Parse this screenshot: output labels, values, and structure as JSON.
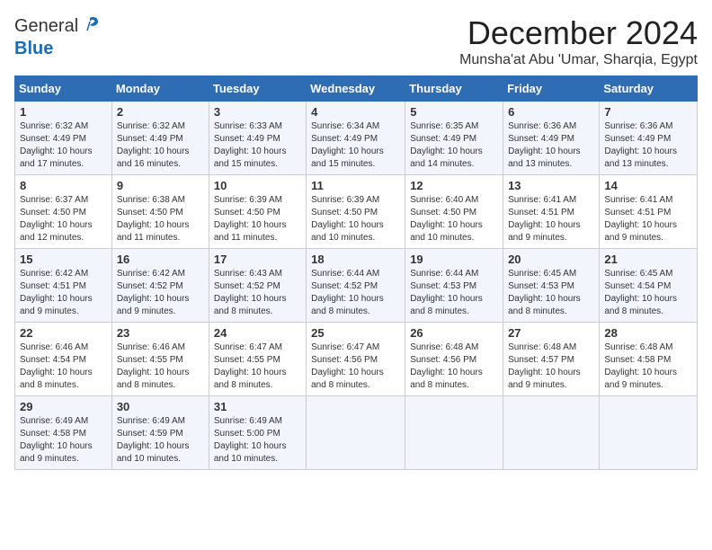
{
  "header": {
    "logo_general": "General",
    "logo_blue": "Blue",
    "month_year": "December 2024",
    "location": "Munsha'at Abu 'Umar, Sharqia, Egypt"
  },
  "days_of_week": [
    "Sunday",
    "Monday",
    "Tuesday",
    "Wednesday",
    "Thursday",
    "Friday",
    "Saturday"
  ],
  "weeks": [
    [
      {
        "day": "1",
        "sunrise": "6:32 AM",
        "sunset": "4:49 PM",
        "daylight": "10 hours and 17 minutes."
      },
      {
        "day": "2",
        "sunrise": "6:32 AM",
        "sunset": "4:49 PM",
        "daylight": "10 hours and 16 minutes."
      },
      {
        "day": "3",
        "sunrise": "6:33 AM",
        "sunset": "4:49 PM",
        "daylight": "10 hours and 15 minutes."
      },
      {
        "day": "4",
        "sunrise": "6:34 AM",
        "sunset": "4:49 PM",
        "daylight": "10 hours and 15 minutes."
      },
      {
        "day": "5",
        "sunrise": "6:35 AM",
        "sunset": "4:49 PM",
        "daylight": "10 hours and 14 minutes."
      },
      {
        "day": "6",
        "sunrise": "6:36 AM",
        "sunset": "4:49 PM",
        "daylight": "10 hours and 13 minutes."
      },
      {
        "day": "7",
        "sunrise": "6:36 AM",
        "sunset": "4:49 PM",
        "daylight": "10 hours and 13 minutes."
      }
    ],
    [
      {
        "day": "8",
        "sunrise": "6:37 AM",
        "sunset": "4:50 PM",
        "daylight": "10 hours and 12 minutes."
      },
      {
        "day": "9",
        "sunrise": "6:38 AM",
        "sunset": "4:50 PM",
        "daylight": "10 hours and 11 minutes."
      },
      {
        "day": "10",
        "sunrise": "6:39 AM",
        "sunset": "4:50 PM",
        "daylight": "10 hours and 11 minutes."
      },
      {
        "day": "11",
        "sunrise": "6:39 AM",
        "sunset": "4:50 PM",
        "daylight": "10 hours and 10 minutes."
      },
      {
        "day": "12",
        "sunrise": "6:40 AM",
        "sunset": "4:50 PM",
        "daylight": "10 hours and 10 minutes."
      },
      {
        "day": "13",
        "sunrise": "6:41 AM",
        "sunset": "4:51 PM",
        "daylight": "10 hours and 9 minutes."
      },
      {
        "day": "14",
        "sunrise": "6:41 AM",
        "sunset": "4:51 PM",
        "daylight": "10 hours and 9 minutes."
      }
    ],
    [
      {
        "day": "15",
        "sunrise": "6:42 AM",
        "sunset": "4:51 PM",
        "daylight": "10 hours and 9 minutes."
      },
      {
        "day": "16",
        "sunrise": "6:42 AM",
        "sunset": "4:52 PM",
        "daylight": "10 hours and 9 minutes."
      },
      {
        "day": "17",
        "sunrise": "6:43 AM",
        "sunset": "4:52 PM",
        "daylight": "10 hours and 8 minutes."
      },
      {
        "day": "18",
        "sunrise": "6:44 AM",
        "sunset": "4:52 PM",
        "daylight": "10 hours and 8 minutes."
      },
      {
        "day": "19",
        "sunrise": "6:44 AM",
        "sunset": "4:53 PM",
        "daylight": "10 hours and 8 minutes."
      },
      {
        "day": "20",
        "sunrise": "6:45 AM",
        "sunset": "4:53 PM",
        "daylight": "10 hours and 8 minutes."
      },
      {
        "day": "21",
        "sunrise": "6:45 AM",
        "sunset": "4:54 PM",
        "daylight": "10 hours and 8 minutes."
      }
    ],
    [
      {
        "day": "22",
        "sunrise": "6:46 AM",
        "sunset": "4:54 PM",
        "daylight": "10 hours and 8 minutes."
      },
      {
        "day": "23",
        "sunrise": "6:46 AM",
        "sunset": "4:55 PM",
        "daylight": "10 hours and 8 minutes."
      },
      {
        "day": "24",
        "sunrise": "6:47 AM",
        "sunset": "4:55 PM",
        "daylight": "10 hours and 8 minutes."
      },
      {
        "day": "25",
        "sunrise": "6:47 AM",
        "sunset": "4:56 PM",
        "daylight": "10 hours and 8 minutes."
      },
      {
        "day": "26",
        "sunrise": "6:48 AM",
        "sunset": "4:56 PM",
        "daylight": "10 hours and 8 minutes."
      },
      {
        "day": "27",
        "sunrise": "6:48 AM",
        "sunset": "4:57 PM",
        "daylight": "10 hours and 9 minutes."
      },
      {
        "day": "28",
        "sunrise": "6:48 AM",
        "sunset": "4:58 PM",
        "daylight": "10 hours and 9 minutes."
      }
    ],
    [
      {
        "day": "29",
        "sunrise": "6:49 AM",
        "sunset": "4:58 PM",
        "daylight": "10 hours and 9 minutes."
      },
      {
        "day": "30",
        "sunrise": "6:49 AM",
        "sunset": "4:59 PM",
        "daylight": "10 hours and 10 minutes."
      },
      {
        "day": "31",
        "sunrise": "6:49 AM",
        "sunset": "5:00 PM",
        "daylight": "10 hours and 10 minutes."
      },
      null,
      null,
      null,
      null
    ]
  ]
}
